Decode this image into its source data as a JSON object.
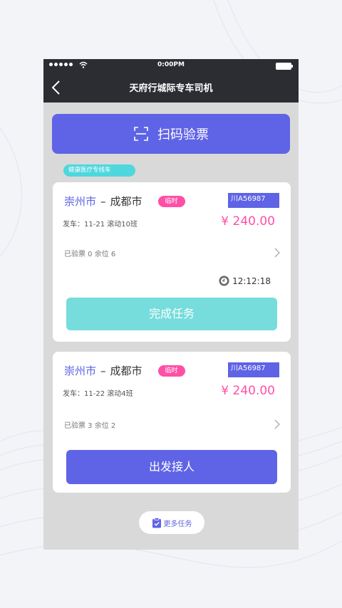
{
  "status_bar": {
    "time": "0:00PM"
  },
  "nav": {
    "title": "天府行城际专车司机"
  },
  "scan": {
    "label": "扫码验票"
  },
  "route_tag": "健康医疗专线车",
  "trips": [
    {
      "from": "崇州市",
      "dash": "–",
      "to": "成都市",
      "badge": "临时",
      "plate": "川A56987",
      "depart": "发车：11-21 滚动10班",
      "price": "¥ 240.00",
      "tickets": "已验票 0  余位 6",
      "timer": "12:12:18",
      "action": "完成任务"
    },
    {
      "from": "崇州市",
      "dash": "–",
      "to": "成都市",
      "badge": "临时",
      "plate": "川A56987",
      "depart": "发车：11-22 滚动4班",
      "price": "¥ 240.00",
      "tickets": "已验票 3  余位 2",
      "action": "出发接人"
    }
  ],
  "more": {
    "label": "更多任务"
  },
  "colors": {
    "primary": "#5f63e6",
    "accent_pink": "#ff4fa6",
    "teal": "#4fd7de",
    "complete": "#76dcdc",
    "header": "#2b2d33"
  }
}
